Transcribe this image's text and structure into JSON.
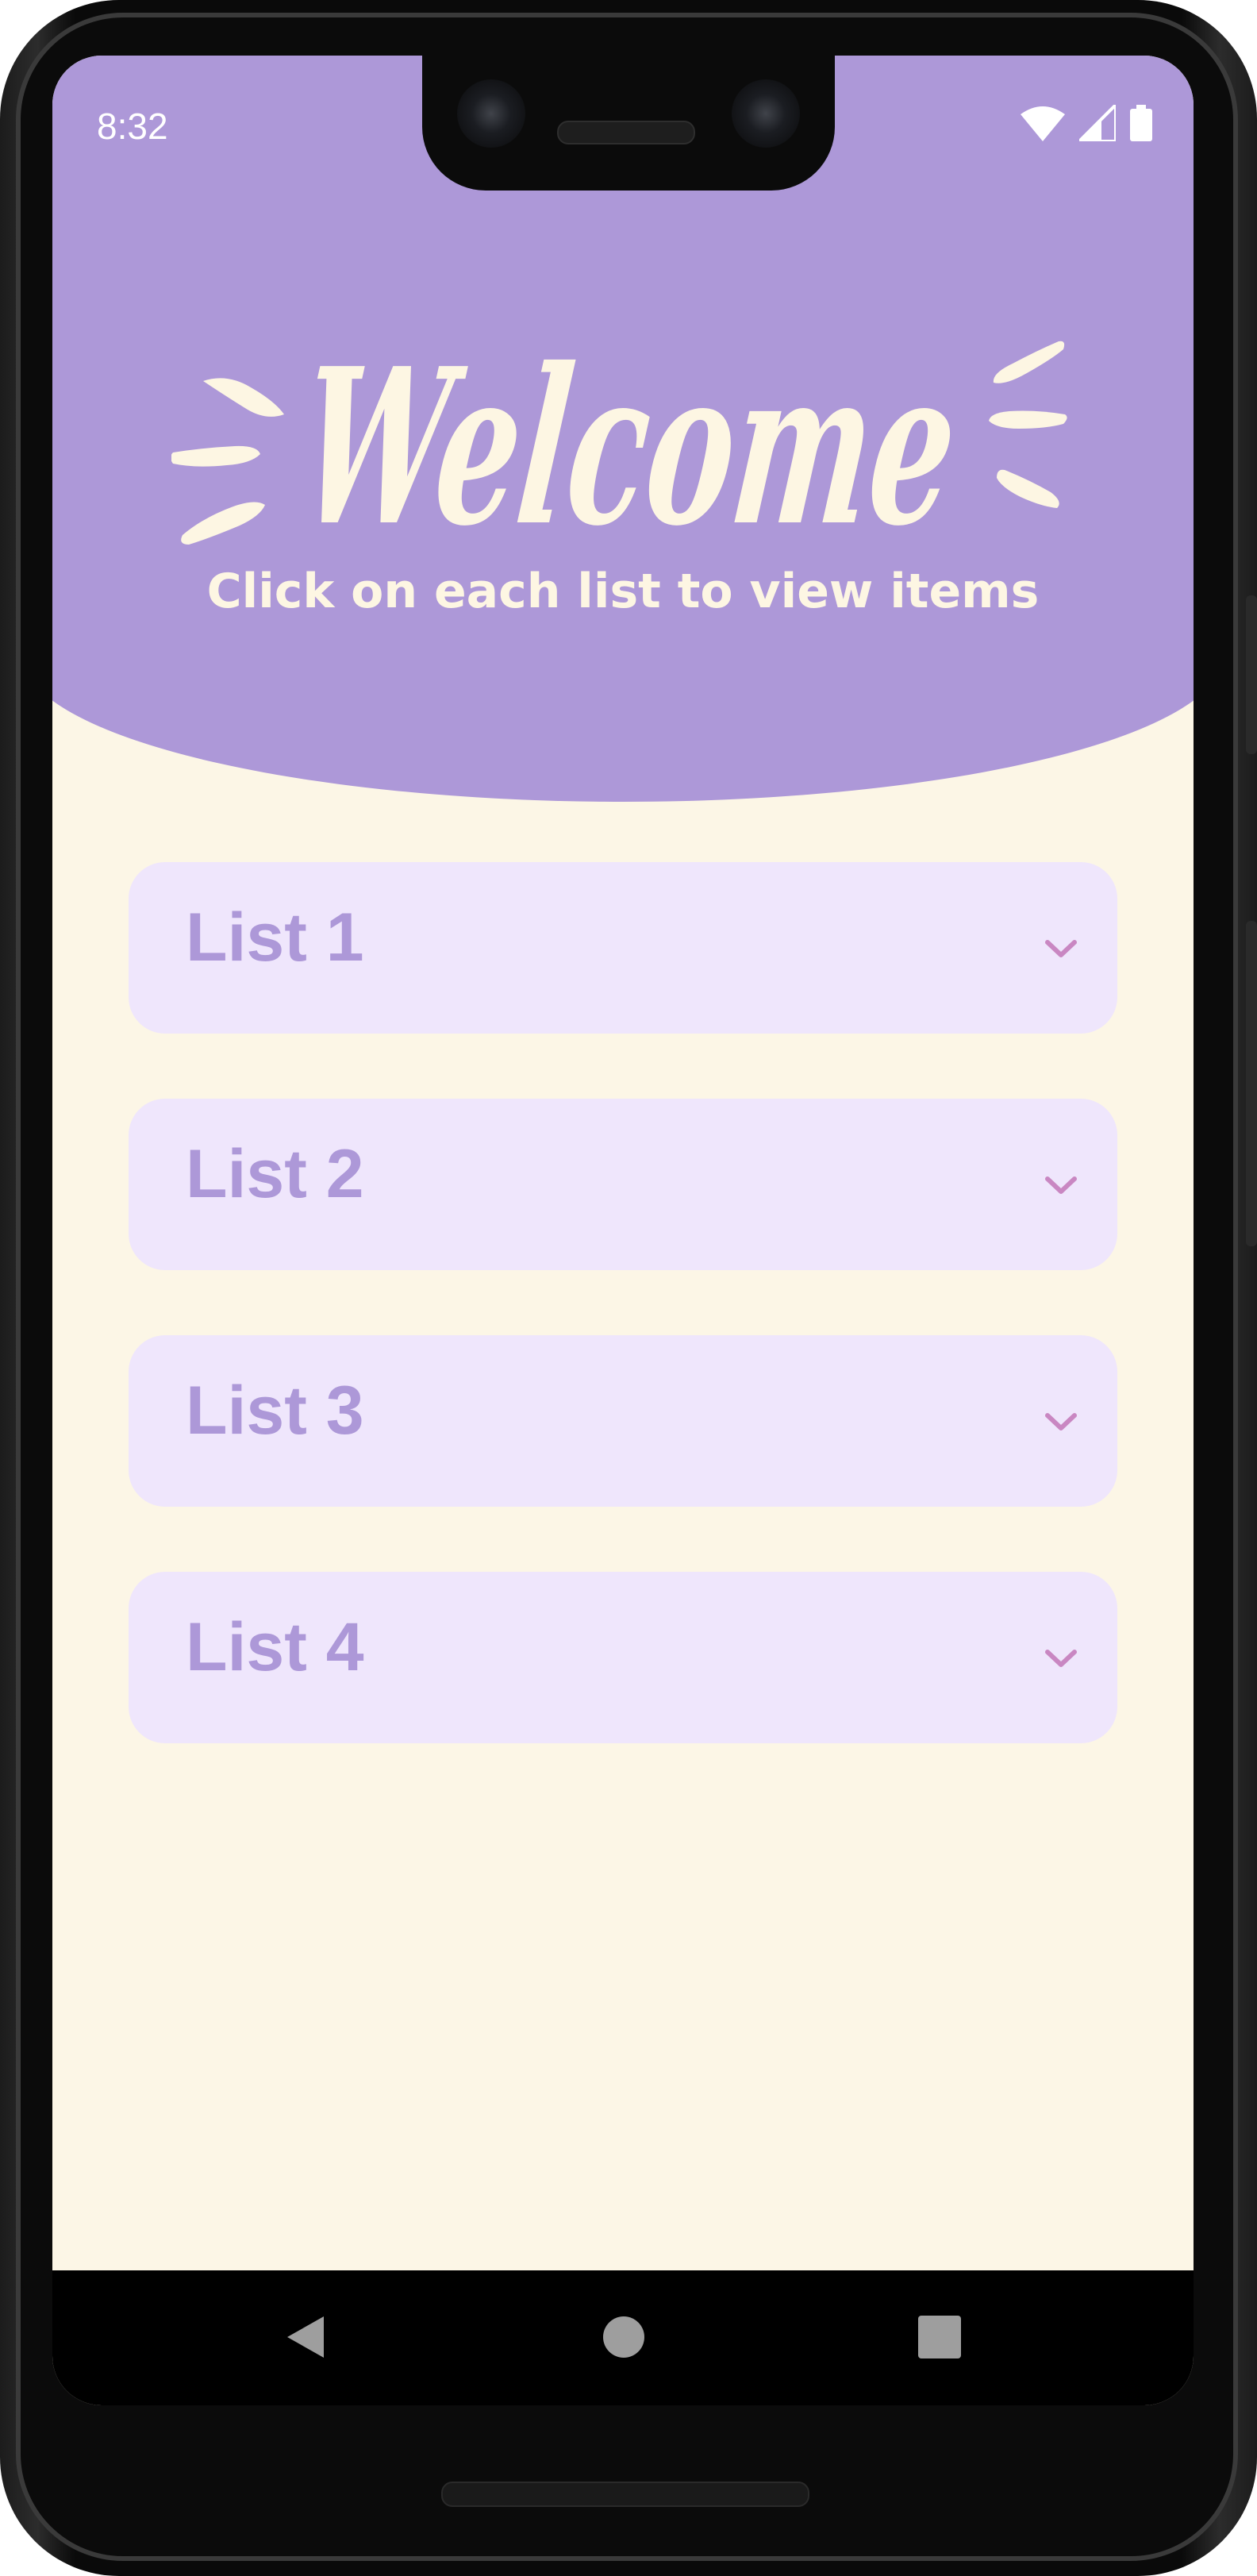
{
  "status_bar": {
    "time": "8:32",
    "icons": [
      "wifi-icon",
      "cell-signal-icon",
      "battery-icon"
    ]
  },
  "header": {
    "logo_text": "Welcome",
    "subtitle": "Click on each list to view items"
  },
  "lists": [
    {
      "label": "List 1"
    },
    {
      "label": "List 2"
    },
    {
      "label": "List 3"
    },
    {
      "label": "List 4"
    }
  ],
  "nav_bar": {
    "buttons": [
      "back-icon",
      "home-icon",
      "recents-icon"
    ]
  },
  "colors": {
    "header_bg": "#ad98d8",
    "screen_bg": "#fcf6e6",
    "card_bg": "#efe6fc",
    "card_text": "#ad98d8",
    "chevron": "#c987c2",
    "logo_text": "#fdf6e3"
  }
}
